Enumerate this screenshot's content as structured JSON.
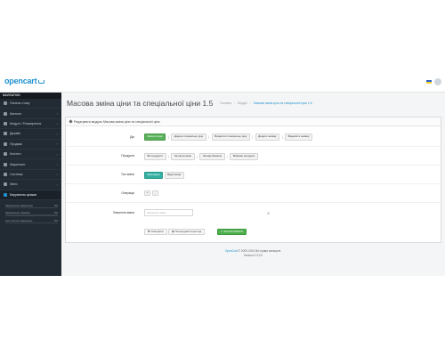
{
  "app": {
    "logo": "opencart"
  },
  "sidebar": {
    "header": "NAVIGATION",
    "items": [
      {
        "label": "Панель стану",
        "icon": "dashboard-icon",
        "arrow": ""
      },
      {
        "label": "Каталог",
        "icon": "tag-icon",
        "arrow": "›"
      },
      {
        "label": "Модулі / Розширення",
        "icon": "puzzle-icon",
        "arrow": "›"
      },
      {
        "label": "Дизайн",
        "icon": "monitor-icon",
        "arrow": "›"
      },
      {
        "label": "Продажі",
        "icon": "cart-icon",
        "arrow": "›"
      },
      {
        "label": "Клієнти",
        "icon": "user-icon",
        "arrow": "›"
      },
      {
        "label": "Маркетинг",
        "icon": "share-icon",
        "arrow": "›"
      },
      {
        "label": "Система",
        "icon": "gear-icon",
        "arrow": "›"
      },
      {
        "label": "Звіти",
        "icon": "chart-icon",
        "arrow": "›"
      },
      {
        "label": "Керування цінами",
        "icon": "price-icon",
        "arrow": ""
      }
    ],
    "stats": [
      {
        "label": "Замовлення завершено",
        "value": "0%",
        "fill": 0
      },
      {
        "label": "Замовлення обробка",
        "value": "0%",
        "fill": 0
      },
      {
        "label": "Інші статуси замовлень",
        "value": "0%",
        "fill": 0
      }
    ]
  },
  "page": {
    "title": "Масова зміна ціни та спеціальної ціни 1.5",
    "breadcrumb": [
      "Головна",
      "Модулі",
      "Масова зміна ціни та спеціальної ціни 1.5"
    ]
  },
  "panel": {
    "heading": "Редагувати модуль Масова зміна ціни та спеціальної ціни"
  },
  "form": {
    "action": {
      "label": "Дія",
      "options": [
        "Змінити ціну",
        "Додати спеціальну ціну",
        "Видалити спеціальну ціну",
        "Додати знижку",
        "Видалити знижку"
      ]
    },
    "products": {
      "label": "Продукти",
      "options": [
        "Всі продукти",
        "За категорією",
        "За виробником",
        "Вибрані продукти"
      ]
    },
    "change_type": {
      "label": "Тип зміни",
      "options": [
        "Фіксована",
        "Відсоткова"
      ]
    },
    "operation": {
      "label": "Операція",
      "plus": "+",
      "minus": "-"
    },
    "change_value": {
      "label": "Значення зміни",
      "placeholder": "Значення зміни",
      "addon": "⊞"
    },
    "buttons": {
      "cancel": "Скасувати",
      "preview": "Попередній перегляд",
      "apply": "ЗАСТОСУВАТИ"
    }
  },
  "footer": {
    "link": "OpenCart",
    "copyright": " © 2009-2024 Всі права захищені.",
    "version": "Version 2.3.0.2"
  },
  "colors": {
    "accent": "#1e91cf",
    "sidebar": "#222a33",
    "success": "#59b05a",
    "teal": "#35b0a0"
  }
}
